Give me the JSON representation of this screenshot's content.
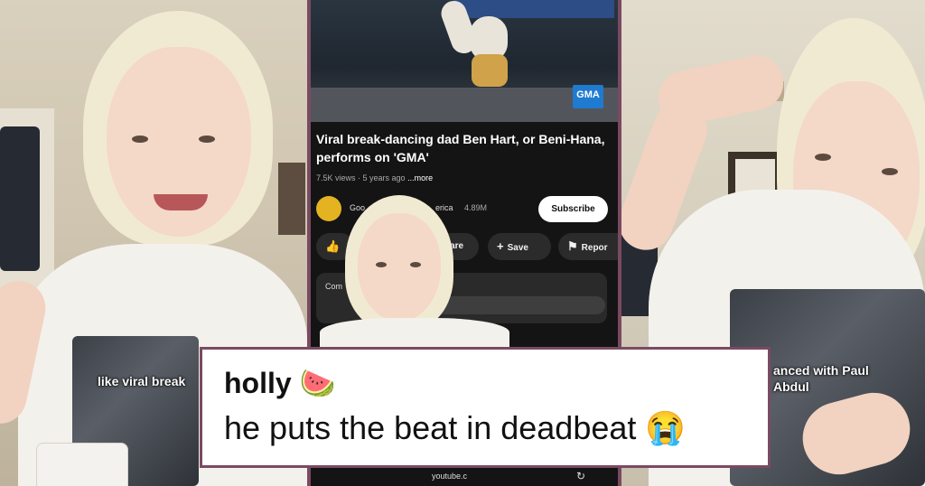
{
  "left_panel": {
    "caption": "like viral break"
  },
  "right_panel": {
    "caption_line1": "anced with Paul",
    "caption_line2": "Abdul"
  },
  "video": {
    "badge": "GMA"
  },
  "youtube": {
    "title": "Viral break-dancing dad Ben Hart, or Beni-Hana, performs on 'GMA'",
    "views": "7.5K views · 5 years ago",
    "more": "...more",
    "channel": "Goo",
    "channel_tail": "erica",
    "subscribers": "4.89M",
    "subscribe_label": "Subscribe",
    "actions": [
      {
        "icon": "👍",
        "label": ""
      },
      {
        "icon": "",
        "label": "hare"
      },
      {
        "icon": "+",
        "label": "Save"
      },
      {
        "icon": "⚑",
        "label": "Repor"
      }
    ],
    "comments_label": "Com",
    "bottom_url": "youtube.c",
    "refresh_icon": "↻"
  },
  "comment": {
    "username": "holly",
    "username_emoji": "🍉",
    "text": "he puts the beat in deadbeat",
    "text_emoji": "😭"
  },
  "colors": {
    "frame": "#7a4a62",
    "youtube_bg": "#141414",
    "subscribe_bg": "#ffffff"
  }
}
